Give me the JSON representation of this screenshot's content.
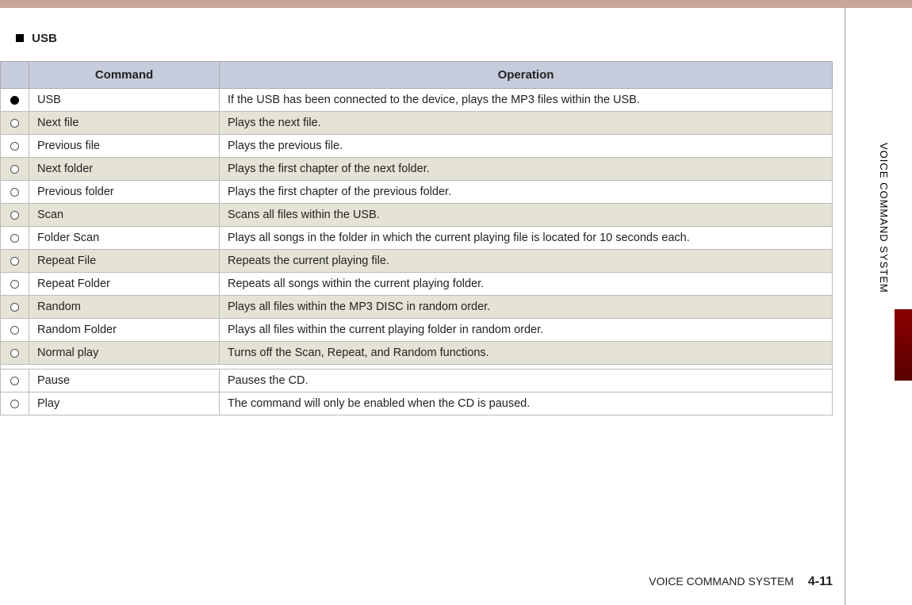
{
  "section_title": "USB",
  "table": {
    "headers": {
      "command": "Command",
      "operation": "Operation"
    },
    "rows": [
      {
        "bullet": "filled",
        "command": "USB",
        "operation": "If the USB has been connected to the device, plays the MP3 files within the USB.",
        "alt": false
      },
      {
        "bullet": "open",
        "command": "Next file",
        "operation": "Plays the next file.",
        "alt": true
      },
      {
        "bullet": "open",
        "command": "Previous file",
        "operation": "Plays the previous file.",
        "alt": false
      },
      {
        "bullet": "open",
        "command": "Next folder",
        "operation": "Plays the first chapter of the next folder.",
        "alt": true
      },
      {
        "bullet": "open",
        "command": "Previous folder",
        "operation": "Plays the first chapter of the previous folder.",
        "alt": false
      },
      {
        "bullet": "open",
        "command": "Scan",
        "operation": "Scans all files within the USB.",
        "alt": true
      },
      {
        "bullet": "open",
        "command": "Folder Scan",
        "operation": "Plays all songs in the folder in which the current playing file is located for 10 seconds each.",
        "alt": false
      },
      {
        "bullet": "open",
        "command": "Repeat File",
        "operation": "Repeats the current playing file.",
        "alt": true
      },
      {
        "bullet": "open",
        "command": "Repeat Folder",
        "operation": "Repeats all songs within the current playing folder.",
        "alt": false
      },
      {
        "bullet": "open",
        "command": "Random",
        "operation": "Plays all files within the MP3 DISC in random order.",
        "alt": true
      },
      {
        "bullet": "open",
        "command": "Random Folder",
        "operation": "Plays all files within the current playing folder in random order.",
        "alt": false
      },
      {
        "bullet": "open",
        "command": "Normal play",
        "operation": "Turns off the Scan, Repeat, and Random functions.",
        "alt": true
      },
      {
        "gap": true
      },
      {
        "bullet": "open",
        "command": "Pause",
        "operation": "Pauses the CD.",
        "alt": false
      },
      {
        "bullet": "open",
        "command": "Play",
        "operation": "The command will only be enabled when the CD is paused.",
        "alt": false
      }
    ]
  },
  "side_label": "VOICE COMMAND SYSTEM",
  "footer": {
    "text": "VOICE COMMAND SYSTEM",
    "page": "4-11"
  }
}
